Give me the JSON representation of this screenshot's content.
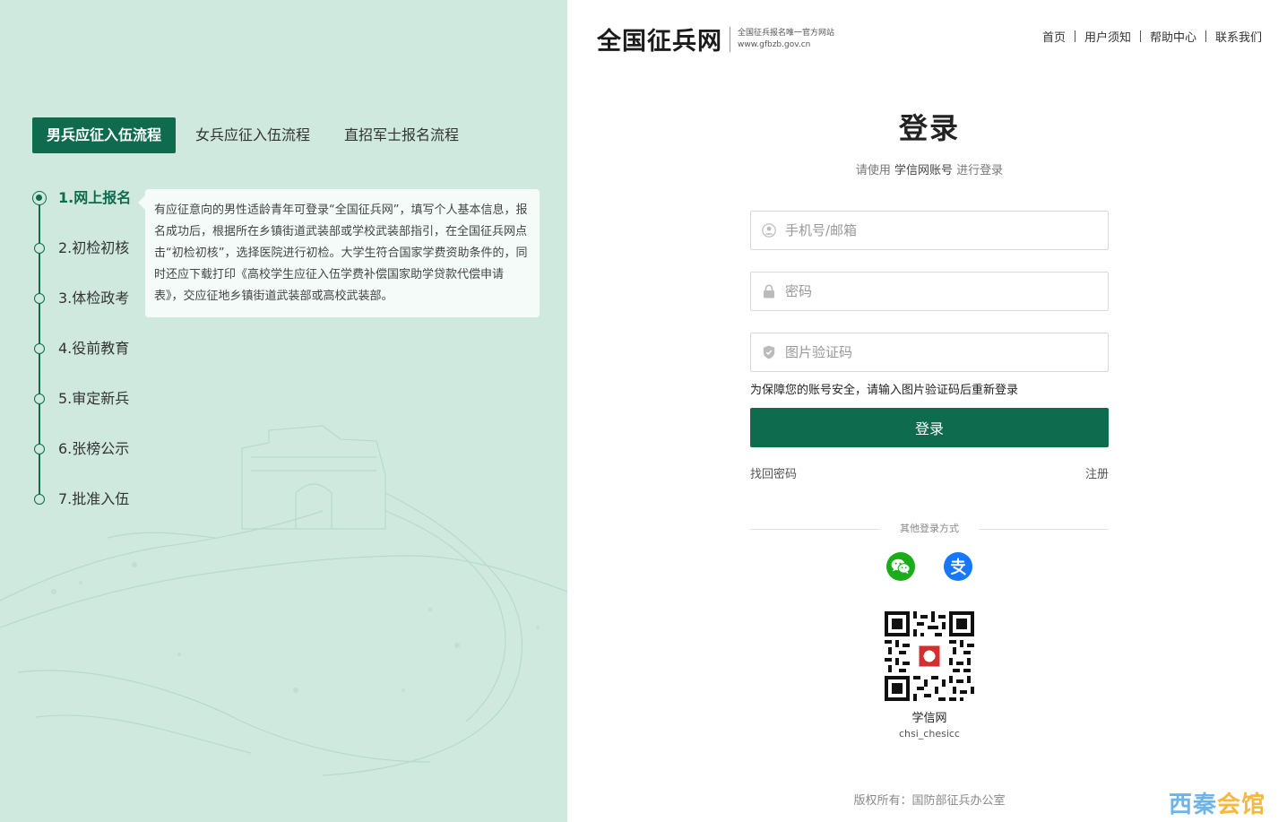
{
  "left": {
    "tabs": [
      "男兵应征入伍流程",
      "女兵应征入伍流程",
      "直招军士报名流程"
    ],
    "steps": [
      "1.网上报名",
      "2.初检初核",
      "3.体检政考",
      "4.役前教育",
      "5.审定新兵",
      "6.张榜公示",
      "7.批准入伍"
    ],
    "description": "有应征意向的男性适龄青年可登录“全国征兵网”，填写个人基本信息，报名成功后，根据所在乡镇街道武装部或学校武装部指引，在全国征兵网点击“初检初核”，选择医院进行初检。大学生符合国家学费资助条件的，同时还应下载打印《高校学生应征入伍学费补偿国家助学贷款代偿申请表》，交应征地乡镇街道武装部或高校武装部。"
  },
  "header": {
    "logo": "全国征兵网",
    "subtitle_1": "全国征兵报名唯一官方网站",
    "subtitle_2": "www.gfbzb.gov.cn",
    "nav": [
      "首页",
      "用户须知",
      "帮助中心",
      "联系我们"
    ]
  },
  "login": {
    "title": "登录",
    "hint_prefix": "请使用 ",
    "hint_account": "学信网账号",
    "hint_suffix": " 进行登录",
    "phone_placeholder": "手机号/邮箱",
    "password_placeholder": "密码",
    "captcha_placeholder": "图片验证码",
    "warning": "为保障您的账号安全，请输入图片验证码后重新登录",
    "submit": "登录",
    "forgot": "找回密码",
    "register": "注册",
    "other_methods": "其他登录方式",
    "qr_name": "学信网",
    "qr_id": "chsi_chesicc"
  },
  "footer": {
    "copyright": "版权所有：国防部征兵办公室"
  },
  "watermark": {
    "part1": "西秦",
    "part2": "会馆"
  },
  "colors": {
    "primary": "#0e6b4d",
    "left_bg": "#cfe9df",
    "wechat": "#1aad19",
    "alipay": "#1677ff"
  },
  "icons": {
    "phone": "user-icon",
    "password": "lock-icon",
    "captcha": "shield-icon",
    "wechat": "wechat-icon",
    "alipay": "alipay-icon"
  }
}
